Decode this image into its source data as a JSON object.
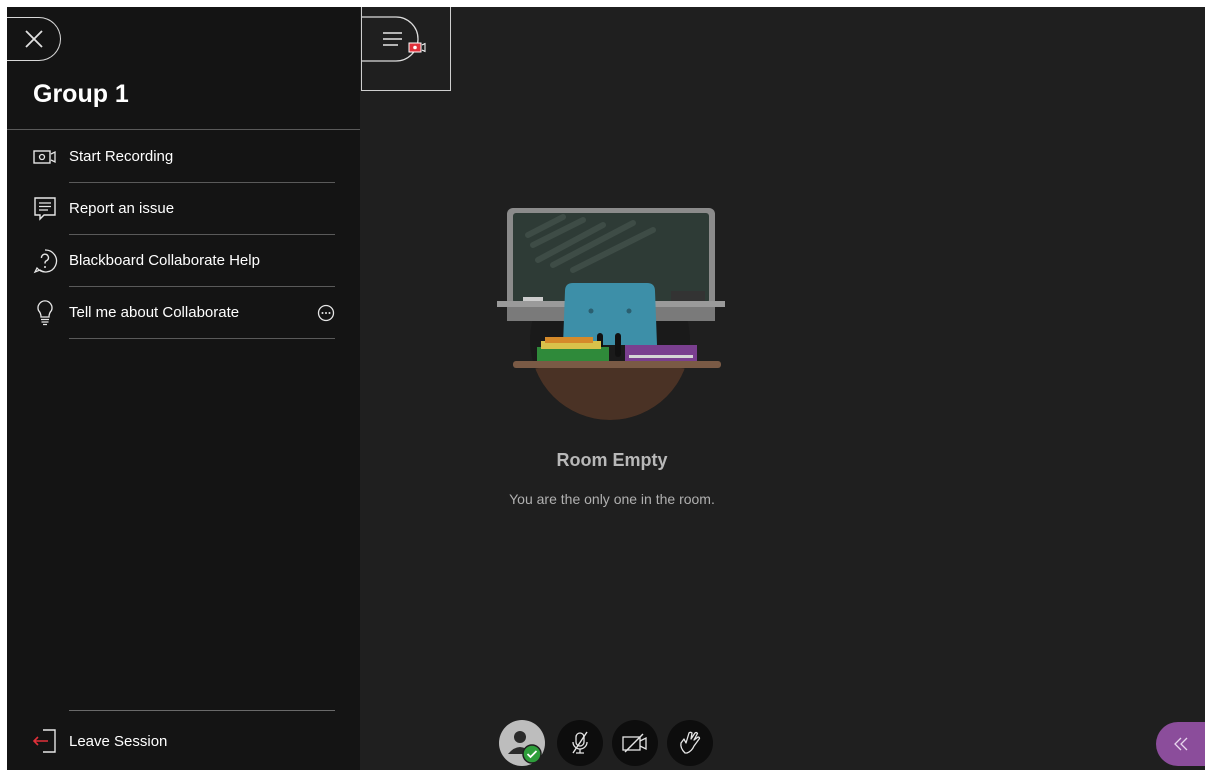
{
  "panel": {
    "title": "Group 1",
    "menu": [
      {
        "label": "Start Recording",
        "icon": "record-icon"
      },
      {
        "label": "Report an issue",
        "icon": "report-issue-icon"
      },
      {
        "label": "Blackboard Collaborate Help",
        "icon": "help-icon"
      },
      {
        "label": "Tell me about Collaborate",
        "icon": "lightbulb-icon"
      }
    ],
    "leave_label": "Leave Session"
  },
  "main": {
    "empty_title": "Room Empty",
    "empty_subtitle": "You are the only one in the room."
  },
  "controls": {
    "items": [
      "avatar-status",
      "microphone-off",
      "camera-off",
      "raise-hand"
    ]
  },
  "colors": {
    "accent": "#8b4d9b",
    "record": "#e0303a",
    "status_ok": "#2e9e3b"
  }
}
